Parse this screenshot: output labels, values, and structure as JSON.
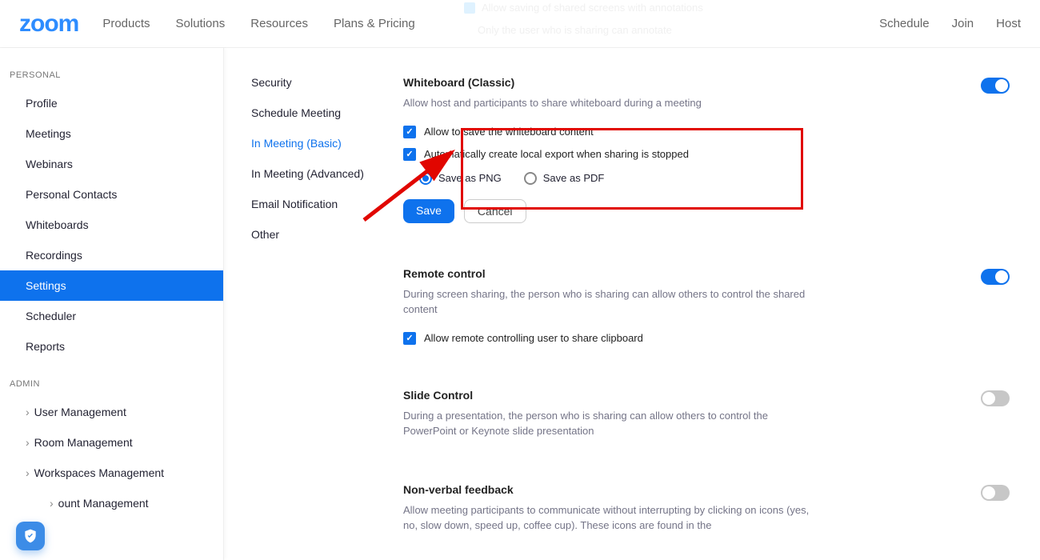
{
  "header": {
    "logo": "zoom",
    "nav": {
      "products": "Products",
      "solutions": "Solutions",
      "resources": "Resources",
      "plans": "Plans & Pricing"
    },
    "right": {
      "schedule": "Schedule",
      "join": "Join",
      "host": "Host"
    },
    "faded1": "Allow saving of shared screens with annotations",
    "faded2": "Only the user who is sharing can annotate"
  },
  "sidebar": {
    "sections": {
      "personal": "PERSONAL",
      "admin": "ADMIN"
    },
    "personal": {
      "profile": "Profile",
      "meetings": "Meetings",
      "webinars": "Webinars",
      "contacts": "Personal Contacts",
      "whiteboards": "Whiteboards",
      "recordings": "Recordings",
      "settings": "Settings",
      "scheduler": "Scheduler",
      "reports": "Reports"
    },
    "admin": {
      "user": "User Management",
      "room": "Room Management",
      "workspaces": "Workspaces Management",
      "account": "ount Management"
    }
  },
  "subnav": {
    "security": "Security",
    "schedule": "Schedule Meeting",
    "basic": "In Meeting (Basic)",
    "advanced": "In Meeting (Advanced)",
    "email": "Email Notification",
    "other": "Other"
  },
  "settings": {
    "whiteboard": {
      "title": "Whiteboard (Classic)",
      "desc": "Allow host and participants to share whiteboard during a meeting",
      "save_opt": "Allow to save the whiteboard content",
      "auto_opt": "Automatically create local export when sharing is stopped",
      "png": "Save as PNG",
      "pdf": "Save as PDF",
      "save_btn": "Save",
      "cancel_btn": "Cancel"
    },
    "remote": {
      "title": "Remote control",
      "desc": "During screen sharing, the person who is sharing can allow others to control the shared content",
      "clipboard": "Allow remote controlling user to share clipboard"
    },
    "slide": {
      "title": "Slide Control",
      "desc": "During a presentation, the person who is sharing can allow others to control the PowerPoint or Keynote slide presentation"
    },
    "nonverbal": {
      "title": "Non-verbal feedback",
      "desc": "Allow meeting participants to communicate without interrupting by clicking on icons (yes, no, slow down, speed up, coffee cup). These icons are found in the"
    }
  }
}
